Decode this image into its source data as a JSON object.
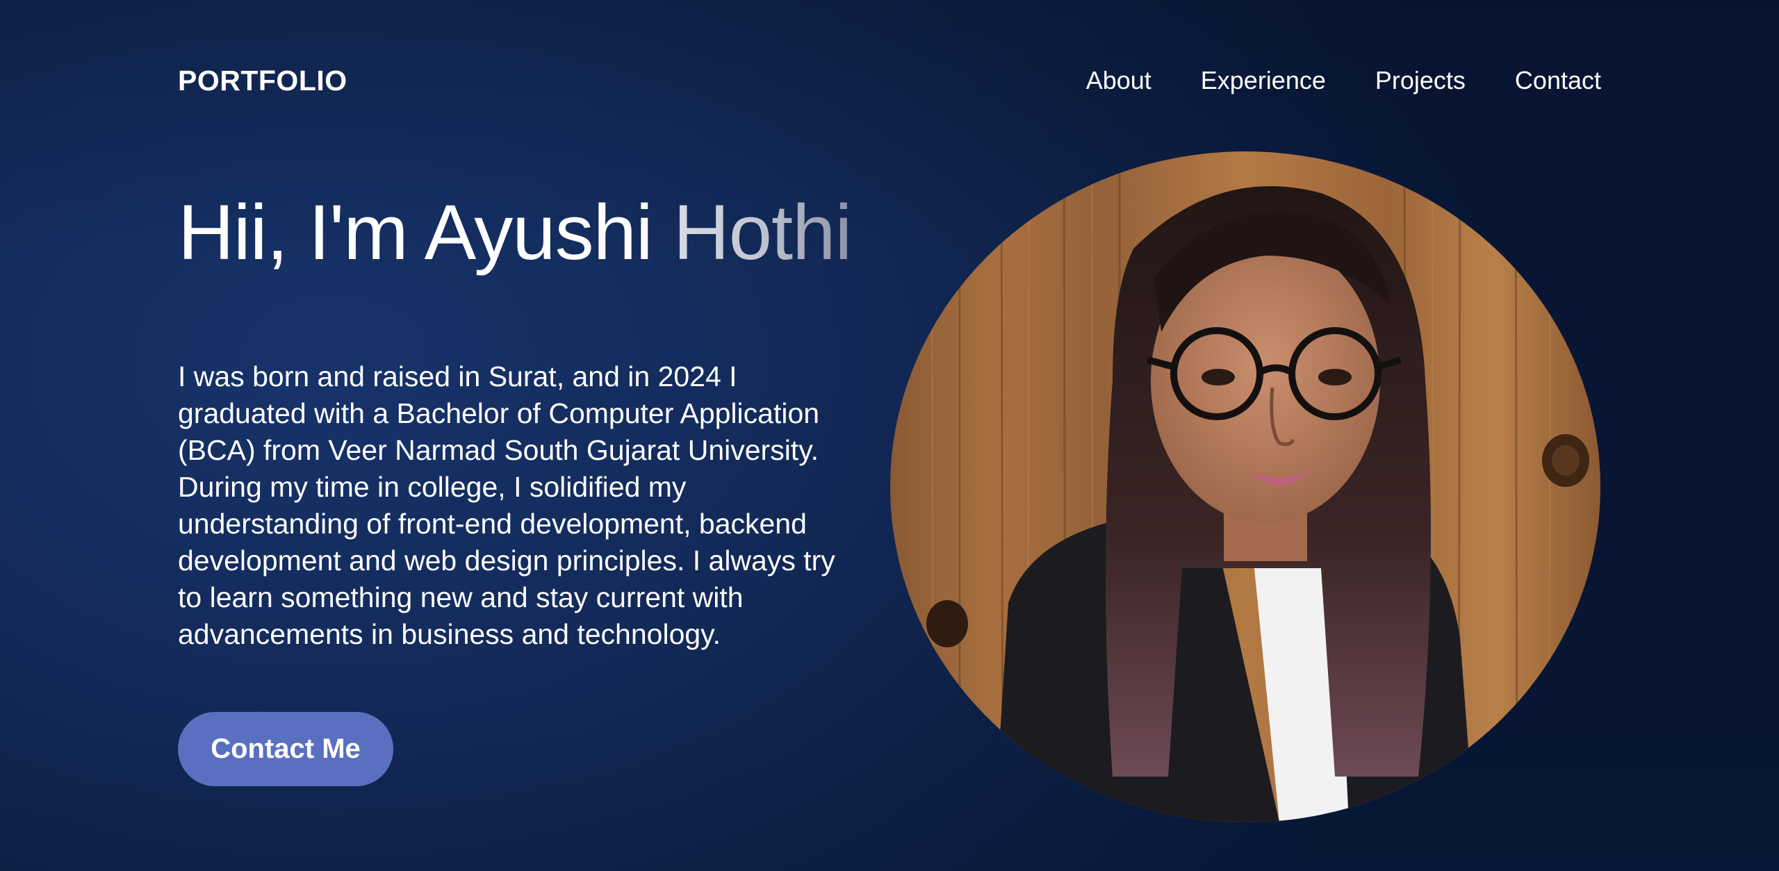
{
  "header": {
    "brand": "PORTFOLIO",
    "nav": [
      {
        "label": "About"
      },
      {
        "label": "Experience"
      },
      {
        "label": "Projects"
      },
      {
        "label": "Contact"
      }
    ]
  },
  "hero": {
    "headline_main": "Hii, I'm Ayushi ",
    "headline_fade": "Hothi",
    "bio": "I was born and raised in Surat, and in 2024 I graduated with a Bachelor of Computer Application (BCA) from Veer Narmad South Gujarat University. During my time in college, I solidified my understanding of front-end development, backend development and web design principles. I always try to learn something new and stay current with advancements in business and technology.",
    "cta_label": "Contact Me"
  },
  "colors": {
    "background": "#132a59",
    "accent_button": "#5a6fbf",
    "text": "#ffffff"
  }
}
